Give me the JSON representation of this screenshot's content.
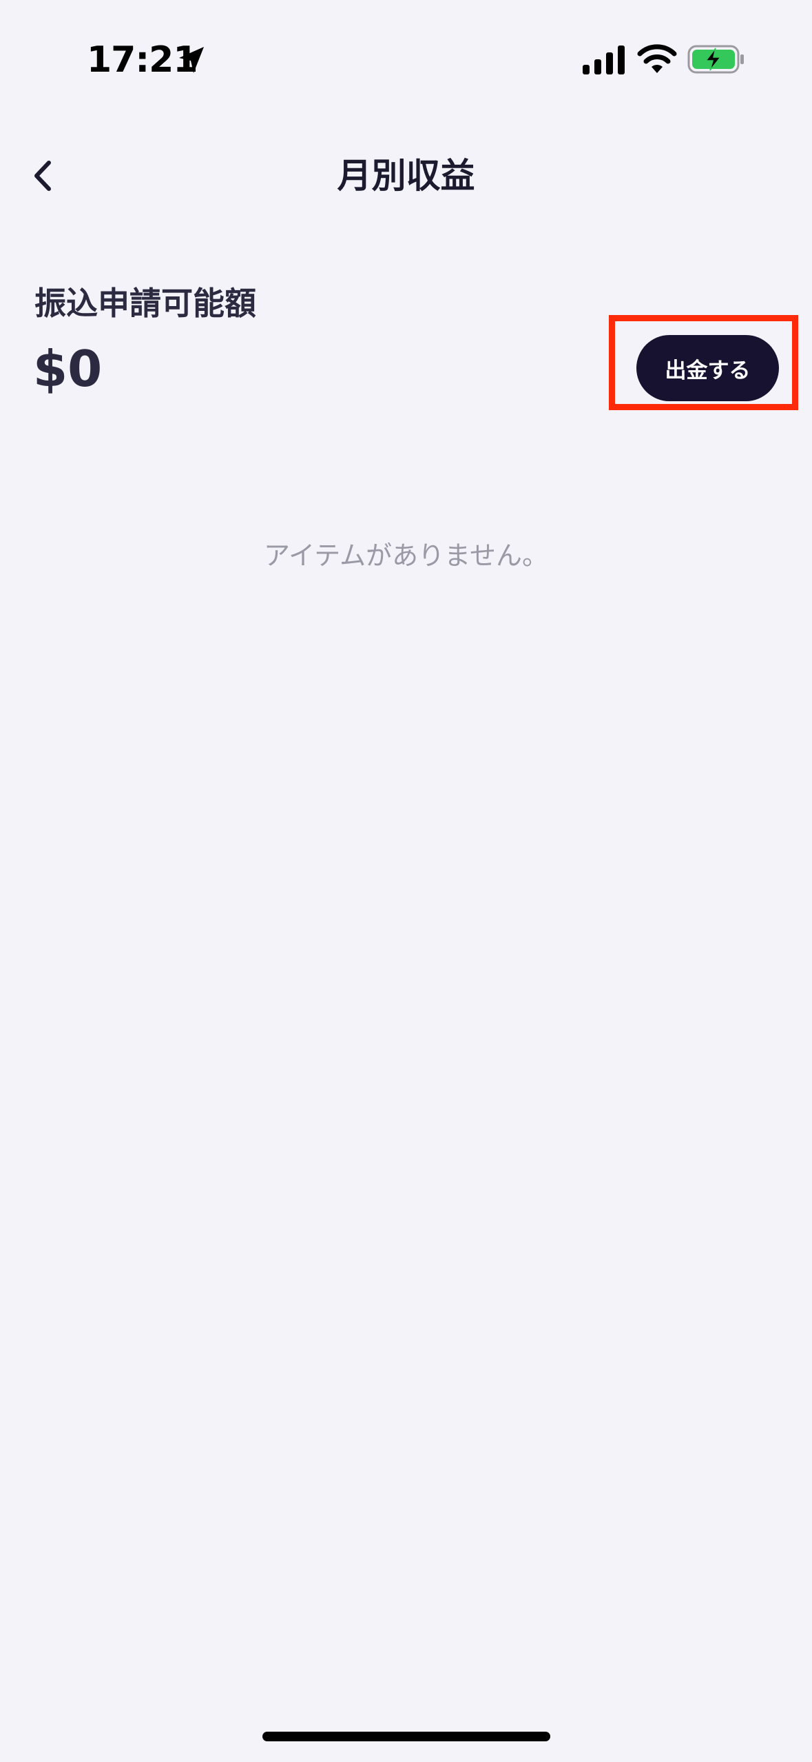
{
  "status_bar": {
    "time": "17:21",
    "battery_color": "#34c759"
  },
  "nav": {
    "title": "月別収益",
    "back_icon": "chevron-left-icon"
  },
  "balance": {
    "label": "振込申請可能額",
    "amount": "$0"
  },
  "actions": {
    "withdraw_label": "出金する",
    "highlight_color": "#ff2a0a",
    "button_color": "#16122f"
  },
  "list": {
    "empty_message": "アイテムがありません。"
  }
}
